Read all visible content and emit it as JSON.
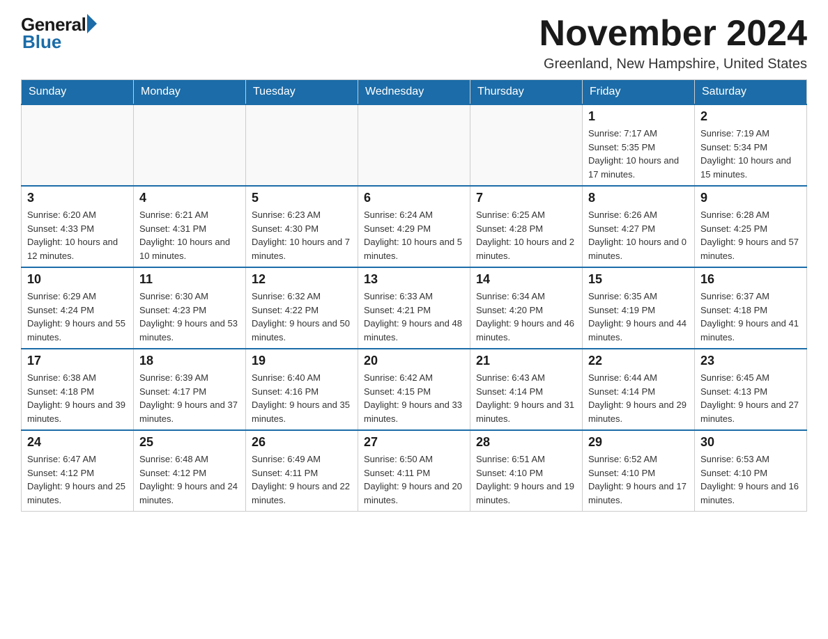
{
  "logo": {
    "general": "General",
    "blue": "Blue"
  },
  "title": "November 2024",
  "location": "Greenland, New Hampshire, United States",
  "days_of_week": [
    "Sunday",
    "Monday",
    "Tuesday",
    "Wednesday",
    "Thursday",
    "Friday",
    "Saturday"
  ],
  "weeks": [
    [
      {
        "day": "",
        "info": ""
      },
      {
        "day": "",
        "info": ""
      },
      {
        "day": "",
        "info": ""
      },
      {
        "day": "",
        "info": ""
      },
      {
        "day": "",
        "info": ""
      },
      {
        "day": "1",
        "info": "Sunrise: 7:17 AM\nSunset: 5:35 PM\nDaylight: 10 hours and 17 minutes."
      },
      {
        "day": "2",
        "info": "Sunrise: 7:19 AM\nSunset: 5:34 PM\nDaylight: 10 hours and 15 minutes."
      }
    ],
    [
      {
        "day": "3",
        "info": "Sunrise: 6:20 AM\nSunset: 4:33 PM\nDaylight: 10 hours and 12 minutes."
      },
      {
        "day": "4",
        "info": "Sunrise: 6:21 AM\nSunset: 4:31 PM\nDaylight: 10 hours and 10 minutes."
      },
      {
        "day": "5",
        "info": "Sunrise: 6:23 AM\nSunset: 4:30 PM\nDaylight: 10 hours and 7 minutes."
      },
      {
        "day": "6",
        "info": "Sunrise: 6:24 AM\nSunset: 4:29 PM\nDaylight: 10 hours and 5 minutes."
      },
      {
        "day": "7",
        "info": "Sunrise: 6:25 AM\nSunset: 4:28 PM\nDaylight: 10 hours and 2 minutes."
      },
      {
        "day": "8",
        "info": "Sunrise: 6:26 AM\nSunset: 4:27 PM\nDaylight: 10 hours and 0 minutes."
      },
      {
        "day": "9",
        "info": "Sunrise: 6:28 AM\nSunset: 4:25 PM\nDaylight: 9 hours and 57 minutes."
      }
    ],
    [
      {
        "day": "10",
        "info": "Sunrise: 6:29 AM\nSunset: 4:24 PM\nDaylight: 9 hours and 55 minutes."
      },
      {
        "day": "11",
        "info": "Sunrise: 6:30 AM\nSunset: 4:23 PM\nDaylight: 9 hours and 53 minutes."
      },
      {
        "day": "12",
        "info": "Sunrise: 6:32 AM\nSunset: 4:22 PM\nDaylight: 9 hours and 50 minutes."
      },
      {
        "day": "13",
        "info": "Sunrise: 6:33 AM\nSunset: 4:21 PM\nDaylight: 9 hours and 48 minutes."
      },
      {
        "day": "14",
        "info": "Sunrise: 6:34 AM\nSunset: 4:20 PM\nDaylight: 9 hours and 46 minutes."
      },
      {
        "day": "15",
        "info": "Sunrise: 6:35 AM\nSunset: 4:19 PM\nDaylight: 9 hours and 44 minutes."
      },
      {
        "day": "16",
        "info": "Sunrise: 6:37 AM\nSunset: 4:18 PM\nDaylight: 9 hours and 41 minutes."
      }
    ],
    [
      {
        "day": "17",
        "info": "Sunrise: 6:38 AM\nSunset: 4:18 PM\nDaylight: 9 hours and 39 minutes."
      },
      {
        "day": "18",
        "info": "Sunrise: 6:39 AM\nSunset: 4:17 PM\nDaylight: 9 hours and 37 minutes."
      },
      {
        "day": "19",
        "info": "Sunrise: 6:40 AM\nSunset: 4:16 PM\nDaylight: 9 hours and 35 minutes."
      },
      {
        "day": "20",
        "info": "Sunrise: 6:42 AM\nSunset: 4:15 PM\nDaylight: 9 hours and 33 minutes."
      },
      {
        "day": "21",
        "info": "Sunrise: 6:43 AM\nSunset: 4:14 PM\nDaylight: 9 hours and 31 minutes."
      },
      {
        "day": "22",
        "info": "Sunrise: 6:44 AM\nSunset: 4:14 PM\nDaylight: 9 hours and 29 minutes."
      },
      {
        "day": "23",
        "info": "Sunrise: 6:45 AM\nSunset: 4:13 PM\nDaylight: 9 hours and 27 minutes."
      }
    ],
    [
      {
        "day": "24",
        "info": "Sunrise: 6:47 AM\nSunset: 4:12 PM\nDaylight: 9 hours and 25 minutes."
      },
      {
        "day": "25",
        "info": "Sunrise: 6:48 AM\nSunset: 4:12 PM\nDaylight: 9 hours and 24 minutes."
      },
      {
        "day": "26",
        "info": "Sunrise: 6:49 AM\nSunset: 4:11 PM\nDaylight: 9 hours and 22 minutes."
      },
      {
        "day": "27",
        "info": "Sunrise: 6:50 AM\nSunset: 4:11 PM\nDaylight: 9 hours and 20 minutes."
      },
      {
        "day": "28",
        "info": "Sunrise: 6:51 AM\nSunset: 4:10 PM\nDaylight: 9 hours and 19 minutes."
      },
      {
        "day": "29",
        "info": "Sunrise: 6:52 AM\nSunset: 4:10 PM\nDaylight: 9 hours and 17 minutes."
      },
      {
        "day": "30",
        "info": "Sunrise: 6:53 AM\nSunset: 4:10 PM\nDaylight: 9 hours and 16 minutes."
      }
    ]
  ]
}
